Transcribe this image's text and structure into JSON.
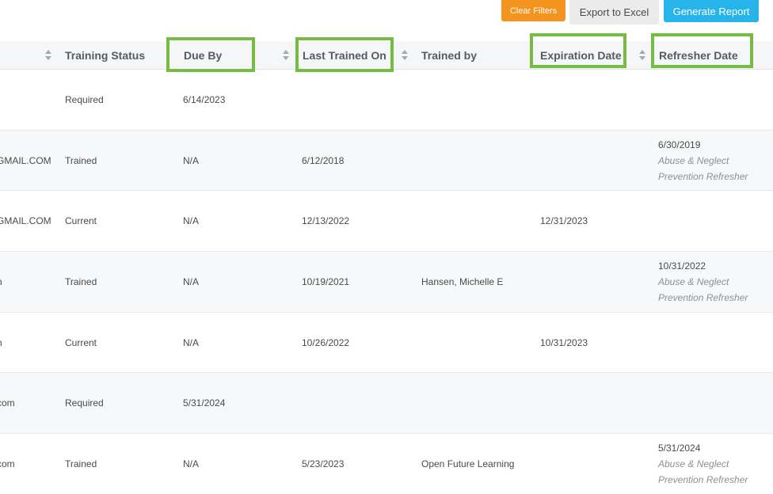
{
  "toolbar": {
    "clear_filters": "Clear Filters",
    "export_excel": "Export to Excel",
    "generate_report": "Generate Report"
  },
  "columns": {
    "training_status": "Training Status",
    "due_by": "Due By",
    "last_trained_on": "Last Trained On",
    "trained_by": "Trained by",
    "expiration_date": "Expiration Date",
    "refresher_date": "Refresher Date"
  },
  "highlight_color": "#76bc43",
  "rows": [
    {
      "email": "",
      "status": "Required",
      "due_by": "6/14/2023",
      "last_trained": "",
      "trained_by": "",
      "expiration": "",
      "refresher_date": "",
      "refresher_line1": "",
      "refresher_line2": ""
    },
    {
      "email": "GMAIL.COM",
      "status": "Trained",
      "due_by": "N/A",
      "last_trained": "6/12/2018",
      "trained_by": "",
      "expiration": "",
      "refresher_date": "6/30/2019",
      "refresher_line1": "Abuse & Neglect",
      "refresher_line2": "Prevention Refresher"
    },
    {
      "email": "GMAIL.COM",
      "status": "Current",
      "due_by": "N/A",
      "last_trained": "12/13/2022",
      "trained_by": "",
      "expiration": "12/31/2023",
      "refresher_date": "",
      "refresher_line1": "",
      "refresher_line2": ""
    },
    {
      "email": "n",
      "status": "Trained",
      "due_by": "N/A",
      "last_trained": "10/19/2021",
      "trained_by": "Hansen, Michelle E",
      "expiration": "",
      "refresher_date": "10/31/2022",
      "refresher_line1": "Abuse & Neglect",
      "refresher_line2": "Prevention Refresher"
    },
    {
      "email": "n",
      "status": "Current",
      "due_by": "N/A",
      "last_trained": "10/26/2022",
      "trained_by": "",
      "expiration": "10/31/2023",
      "refresher_date": "",
      "refresher_line1": "",
      "refresher_line2": ""
    },
    {
      "email": "com",
      "status": "Required",
      "due_by": "5/31/2024",
      "last_trained": "",
      "trained_by": "",
      "expiration": "",
      "refresher_date": "",
      "refresher_line1": "",
      "refresher_line2": ""
    },
    {
      "email": "com",
      "status": "Trained",
      "due_by": "N/A",
      "last_trained": "5/23/2023",
      "trained_by": "Open Future Learning",
      "expiration": "",
      "refresher_date": "5/31/2024",
      "refresher_line1": "Abuse & Neglect",
      "refresher_line2": "Prevention Refresher"
    }
  ]
}
